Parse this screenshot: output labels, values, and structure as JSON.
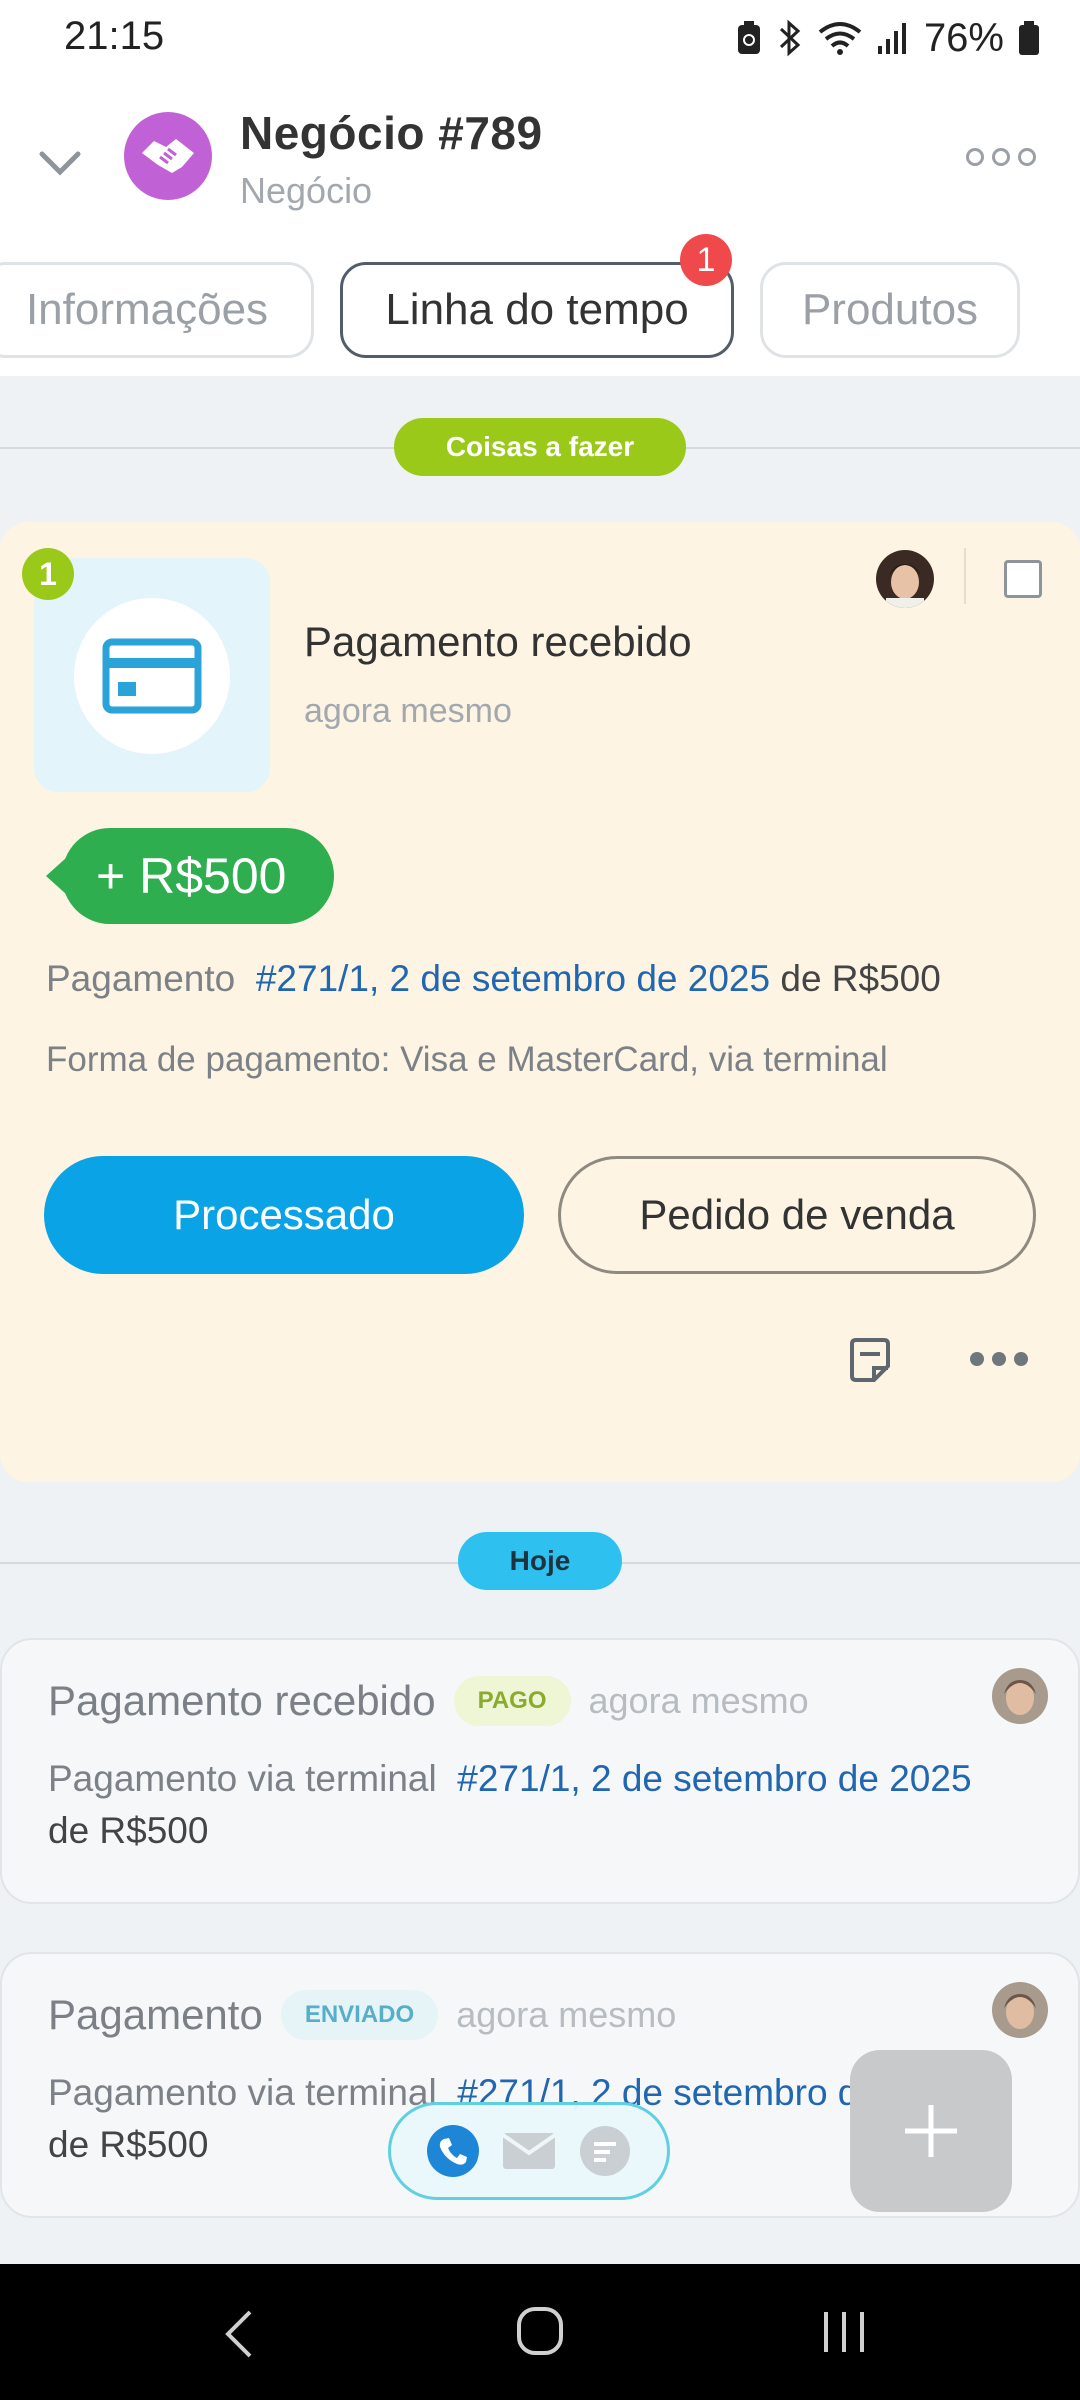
{
  "status": {
    "time": "21:15",
    "battery": "76%"
  },
  "header": {
    "title": "Negócio #789",
    "subtitle": "Negócio"
  },
  "tabs": [
    {
      "label": "Informações"
    },
    {
      "label": "Linha do tempo"
    },
    {
      "label": "Produtos"
    }
  ],
  "tab_badge": "1",
  "todo": {
    "section_label": "Coisas a fazer",
    "counter": "1",
    "title": "Pagamento recebido",
    "time": "agora mesmo",
    "amount": "+ R$500",
    "payment_prefix": "Pagamento",
    "payment_link": "#271/1, 2 de setembro de 2025",
    "payment_suffix": "de R$500",
    "method": "Forma de pagamento: Visa e MasterCard, via terminal",
    "btn_processed": "Processado",
    "btn_order": "Pedido de venda"
  },
  "today_label": "Hoje",
  "timeline": [
    {
      "title": "Pagamento recebido",
      "tag": "PAGO",
      "time": "agora mesmo",
      "line_prefix": "Pagamento via terminal",
      "line_link": "#271/1, 2 de setembro de 2025",
      "line_suffix": "de R$500"
    },
    {
      "title": "Pagamento",
      "tag": "ENVIADO",
      "time": "agora mesmo",
      "line_prefix": "Pagamento via terminal",
      "line_link": "#271/1, 2 de setembro de 2025",
      "line_suffix": "de R$500"
    }
  ],
  "colors": {
    "accent": "#0aa4e6",
    "success": "#2fae4f",
    "todo_bg": "#fdf4e3",
    "lime": "#9bc91a"
  }
}
